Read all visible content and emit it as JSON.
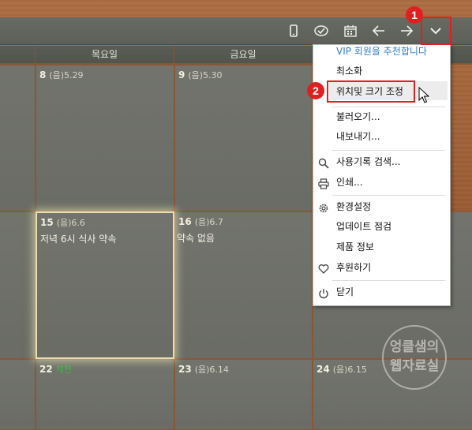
{
  "header": {
    "days": [
      "목요일",
      "금요일"
    ]
  },
  "cells": [
    {
      "num": "8",
      "lunar": "(음)5.29"
    },
    {
      "num": "9",
      "lunar": "(음)5.30"
    },
    {
      "num": "15",
      "lunar": "(음)6.6",
      "note": "저녁 6시 식사 약속"
    },
    {
      "num": "16",
      "lunar": "(음)6.7",
      "note": "약속 없음"
    },
    {
      "num": "22",
      "lunar": "제헌"
    },
    {
      "num": "23",
      "lunar": "(음)6.14"
    },
    {
      "num": "24",
      "lunar": "(음)6.15"
    }
  ],
  "menu": {
    "vip": "VIP 회원을 추천합니다",
    "minimize": "최소화",
    "position_size": "위치및 크기 조정",
    "import": "불러오기...",
    "export": "내보내기...",
    "history_search": "사용기록 검색...",
    "print": "인쇄...",
    "settings": "환경설정",
    "update_check": "업데이트 점검",
    "product_info": "제품 정보",
    "donate": "후원하기",
    "close": "닫기"
  },
  "badges": [
    "1",
    "2"
  ],
  "watermark": {
    "line1": "엉클샘의",
    "line2": "웹자료실"
  },
  "icons": [
    "mobile-icon",
    "check-circle-icon",
    "calendar-icon",
    "arrow-left-icon",
    "arrow-right-icon",
    "chevron-down-icon",
    "search-icon",
    "printer-icon",
    "gear-icon",
    "heart-icon",
    "power-icon"
  ],
  "colors": {
    "accent": "#e02020",
    "vip": "#2f7ccf",
    "holiday": "#3db34a"
  }
}
